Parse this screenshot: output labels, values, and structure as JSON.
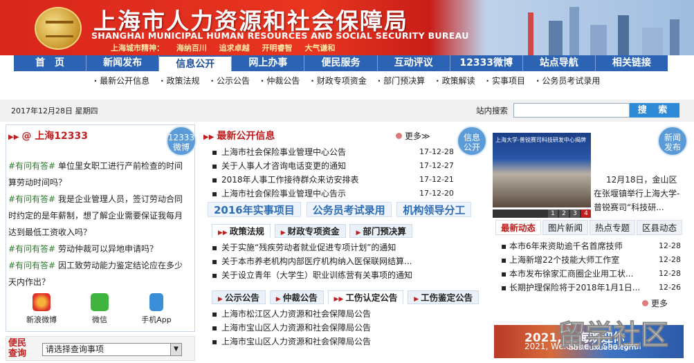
{
  "header": {
    "title_cn": "上海市人力资源和社会保障局",
    "title_en": "SHANGHAI MUNICIPAL HUMAN RESOURCES AND SOCIAL SECURITY BUREAU",
    "motto": "上海城市精神：  海纳百川   追求卓越   开明睿智   大气谦和"
  },
  "nav": [
    "首　页",
    "新闻发布",
    "信息公开",
    "网上办事",
    "便民服务",
    "互动评议",
    "12333微博",
    "站点导航",
    "相关链接"
  ],
  "subnav": [
    "最新公开信息",
    "政策法规",
    "公示公告",
    "仲裁公告",
    "财政专项资金",
    "部门预决算",
    "政策解读",
    "实事项目",
    "公务员考试录用"
  ],
  "datebar": {
    "date": "2017年12月28日  星期四",
    "search_label": "站内搜索",
    "search_button": "搜 索"
  },
  "left": {
    "title": "@ 上海12333",
    "badge": [
      "12333",
      "微博"
    ],
    "qa": [
      {
        "tag": "#有问有答#",
        "text": "单位里女职工进行产前检查的时间算劳动时间吗？"
      },
      {
        "tag": "#有问有答#",
        "text": "我是企业管理人员，签订劳动合同时约定的是年薪制，想了解企业需要保证我每月达到最低工资收入吗？"
      },
      {
        "tag": "#有问有答#",
        "text": "劳动仲裁可以异地申请吗？"
      },
      {
        "tag": "#有问有答#",
        "text": "因工致劳动能力鉴定结论应在多少天内作出？"
      }
    ],
    "social": [
      "新浪微博",
      "微信",
      "手机App"
    ],
    "service": {
      "label": "便民查询",
      "select": "请选择查询事项"
    }
  },
  "mid": {
    "title": "最新公开信息",
    "more": "更多",
    "badge": [
      "信息",
      "公开"
    ],
    "items": [
      {
        "t": "上海市社会保险事业管理中心公告",
        "d": "17-12-28"
      },
      {
        "t": "关于人事人才咨询电话变更的通知",
        "d": "17-12-27"
      },
      {
        "t": "2018年人事工作接待群众来访安排表",
        "d": "17-12-21"
      },
      {
        "t": "上海市社会保险事业管理中心告示",
        "d": "17-12-20"
      }
    ],
    "big_links": [
      "2016年实事项目",
      "公务员考试录用",
      "机构领导分工"
    ],
    "tabs1": [
      "政策法规",
      "财政专项资金",
      "部门预决算"
    ],
    "items2": [
      "关于实施“残疾劳动者就业促进专项计划”的通知",
      "关于本市养老机构内部医疗机构纳入医保联网结算...",
      "关于设立青年（大学生）职业训练营有关事项的通知"
    ],
    "tabs2": [
      "公示公告",
      "仲裁公告",
      "工伤认定公告",
      "工伤鉴定公告"
    ],
    "items3": [
      "上海市松江区人力资源和社会保障局公告",
      "上海市宝山区人力资源和社会保障局公告",
      "上海市宝山区人力资源和社会保障局公告"
    ]
  },
  "right": {
    "badge": [
      "新闻",
      "发布"
    ],
    "photo_caption": "上海大学-普锐赛司科技研发中心揭牌",
    "headline": "12月18日，金山区在张堰镇举行上海大学-普锐赛司“科技研...",
    "pager": [
      "1",
      "2",
      "3",
      "4"
    ],
    "tabs": [
      "最新动态",
      "图片新闻",
      "热点专题",
      "区县动态"
    ],
    "items": [
      {
        "t": "本市6年来资助逾千名首席技师",
        "d": "12-28"
      },
      {
        "t": "上海新增22个技能大师工作室",
        "d": "12-28"
      },
      {
        "t": "本市发布徐家汇商圈企业用工状...",
        "d": "12-28"
      },
      {
        "t": "长期护理保险将于2018年1月1日...",
        "d": "12-26"
      }
    ],
    "more": "更多",
    "promo_year": "2021, 上海欢迎你",
    "promo_en": "2021, Welcome to Shanghai"
  },
  "watermark": {
    "text": "留学社区",
    "url": "bbs.liuxue86.com"
  },
  "colors": {
    "banner_red": "#d9261c",
    "nav_blue": "#2d63b4",
    "accent_red": "#c01d1d",
    "link_blue": "#2f6db5"
  }
}
